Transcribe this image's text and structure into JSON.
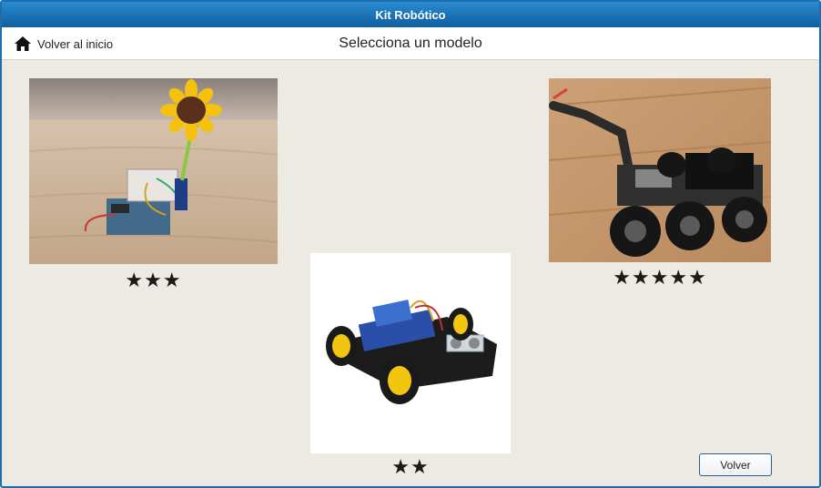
{
  "window": {
    "title": "Kit Robótico"
  },
  "nav": {
    "home_icon": "home-icon",
    "home_label": "Volver al inicio",
    "page_title": "Selecciona un modelo"
  },
  "models": [
    {
      "image": "sunflower-robot-kit-photo",
      "rating": 3,
      "stars": "★★★"
    },
    {
      "image": "smart-robot-car-photo",
      "rating": 2,
      "stars": "★★"
    },
    {
      "image": "robotic-arm-rover-photo",
      "rating": 5,
      "stars": "★★★★★"
    }
  ],
  "footer": {
    "back_label": "Volver"
  },
  "colors": {
    "titlebar": "#1b6fae",
    "background": "#ede9e3",
    "stars": "#1a1a1a"
  }
}
